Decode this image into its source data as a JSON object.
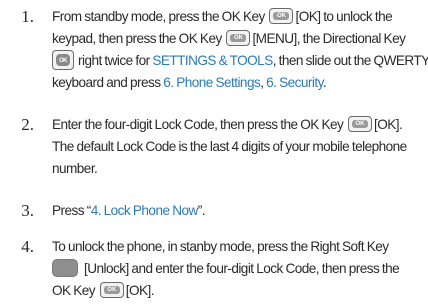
{
  "icons": {
    "ok_key_text": "OK",
    "ok_icon": "ok-key-icon",
    "directional_icon": "directional-key-icon",
    "soft_key_icon": "right-soft-key-icon"
  },
  "colors": {
    "text": "#2a2a2a",
    "link": "#2a7ab8"
  },
  "steps": [
    {
      "number": "1.",
      "l1a": "From standby mode, press the OK Key",
      "l1b": "[OK] to unlock the",
      "l2a": "keypad, then press the OK Key",
      "l2b": "[MENU], the Directional Key",
      "l3a": "right twice for",
      "l3link": "SETTINGS & TOOLS",
      "l3b": ", then slide out the QWERTY",
      "l4a": "keyboard and press",
      "l4link1": "6. Phone Settings",
      "l4mid": ",",
      "l4link2": "6. Security",
      "l4b": "."
    },
    {
      "number": "2.",
      "l1a": "Enter the four-digit Lock Code, then press the OK Key",
      "l1b": "[OK].",
      "l2": "The default Lock Code is the last 4 digits of your mobile telephone",
      "l3": "number."
    },
    {
      "number": "3.",
      "l1a": "Press “",
      "l1link": "4. Lock Phone Now",
      "l1b": "”."
    },
    {
      "number": "4.",
      "l1": "To unlock the phone, in stanby mode, press the Right Soft Key",
      "l2a": "[Unlock] and enter the four-digit Lock Code, then press the",
      "l3a": "OK Key",
      "l3b": "[OK]."
    }
  ]
}
